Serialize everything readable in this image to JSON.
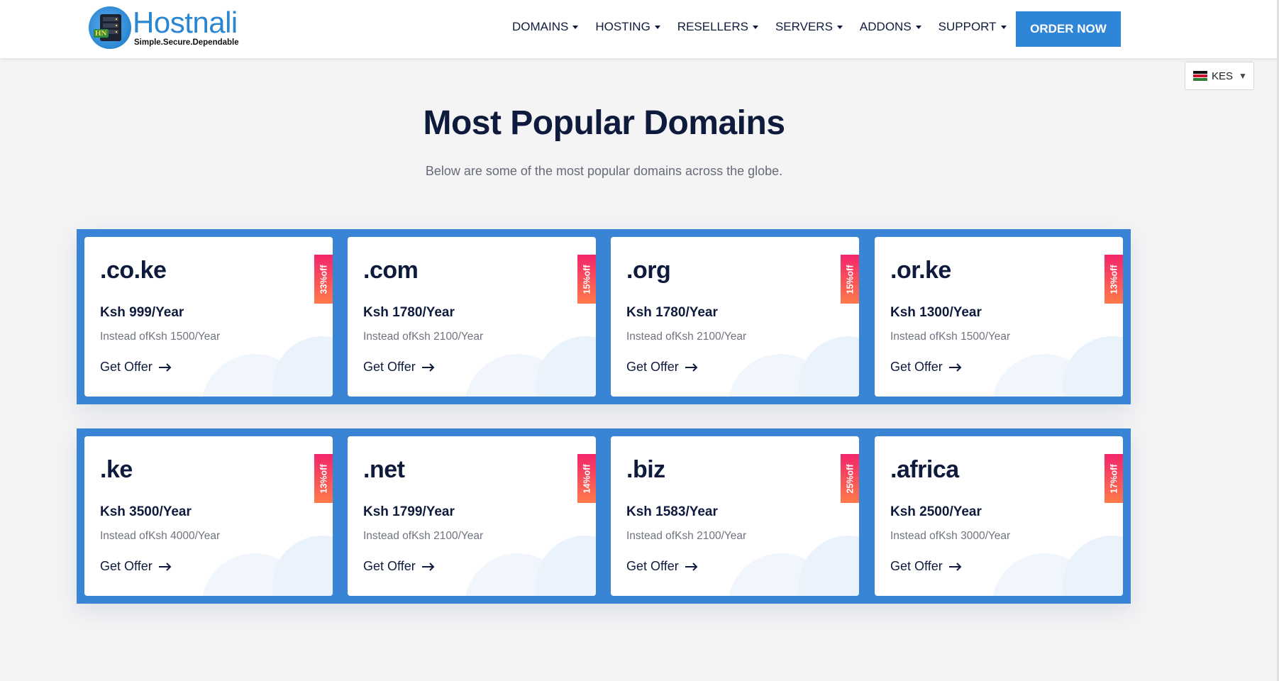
{
  "header": {
    "logo": {
      "name": "Hostnali",
      "tagline": "Simple.Secure.Dependable",
      "badge": "HN"
    },
    "nav": [
      {
        "label": "DOMAINS"
      },
      {
        "label": "HOSTING"
      },
      {
        "label": "RESELLERS"
      },
      {
        "label": "SERVERS"
      },
      {
        "label": "ADDONS"
      },
      {
        "label": "SUPPORT"
      }
    ],
    "order_button": "ORDER NOW"
  },
  "currency": {
    "code": "KES",
    "icon": "kenya-flag-icon"
  },
  "main": {
    "title": "Most Popular Domains",
    "subtitle": "Below are some of the most popular domains across the globe.",
    "cards": [
      {
        "tld": ".co.ke",
        "price": "Ksh 999/Year",
        "old_price": "Instead ofKsh 1500/Year",
        "discount": "33%off",
        "cta": "Get Offer"
      },
      {
        "tld": ".com",
        "price": "Ksh 1780/Year",
        "old_price": "Instead ofKsh 2100/Year",
        "discount": "15%off",
        "cta": "Get Offer"
      },
      {
        "tld": ".org",
        "price": "Ksh 1780/Year",
        "old_price": "Instead ofKsh 2100/Year",
        "discount": "15%off",
        "cta": "Get Offer"
      },
      {
        "tld": ".or.ke",
        "price": "Ksh 1300/Year",
        "old_price": "Instead ofKsh 1500/Year",
        "discount": "13%off",
        "cta": "Get Offer"
      },
      {
        "tld": ".ke",
        "price": "Ksh 3500/Year",
        "old_price": "Instead ofKsh 4000/Year",
        "discount": "13%off",
        "cta": "Get Offer"
      },
      {
        "tld": ".net",
        "price": "Ksh 1799/Year",
        "old_price": "Instead ofKsh 2100/Year",
        "discount": "14%off",
        "cta": "Get Offer"
      },
      {
        "tld": ".biz",
        "price": "Ksh 1583/Year",
        "old_price": "Instead ofKsh 2100/Year",
        "discount": "25%off",
        "cta": "Get Offer"
      },
      {
        "tld": ".africa",
        "price": "Ksh 2500/Year",
        "old_price": "Instead ofKsh 3000/Year",
        "discount": "17%off",
        "cta": "Get Offer"
      }
    ]
  },
  "colors": {
    "brand": "#2f86d8",
    "heading": "#0f1b3d",
    "ribbon_start": "#f2256b",
    "ribbon_end": "#ff7a4a",
    "page_bg": "#f4f4f5"
  }
}
